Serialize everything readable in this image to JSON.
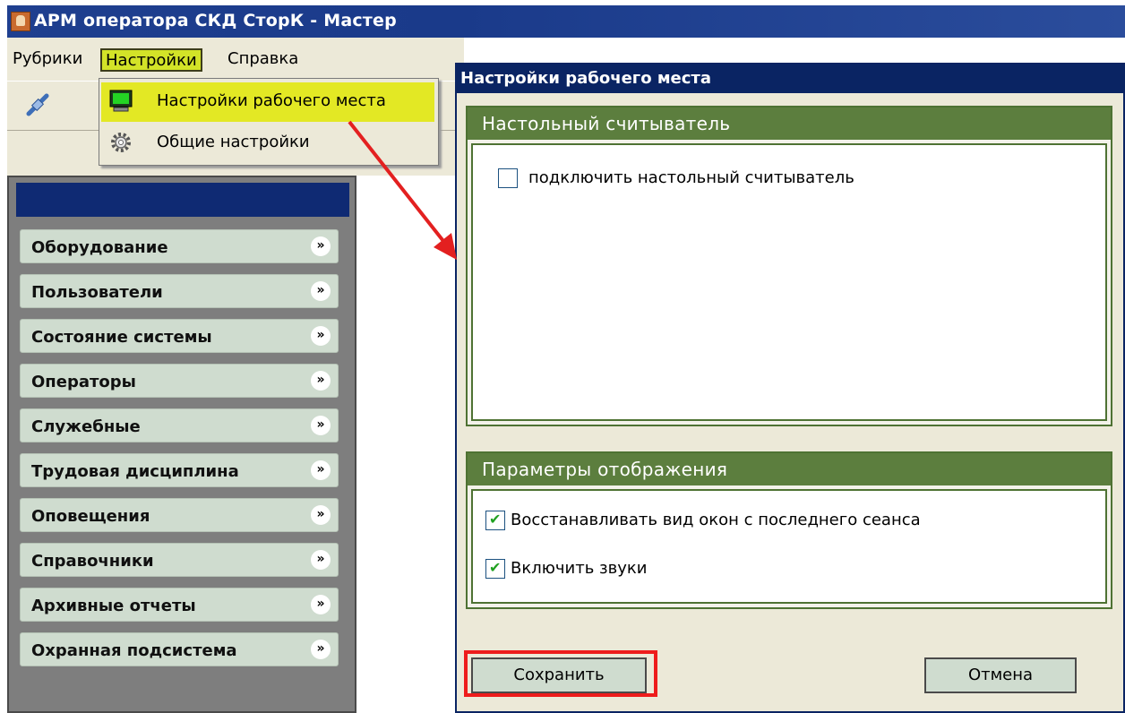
{
  "window": {
    "title": "АРМ оператора СКД СторК - Мастер"
  },
  "menubar": {
    "items": [
      {
        "label": "Рубрики"
      },
      {
        "label": "Настройки"
      },
      {
        "label": "Справка"
      }
    ]
  },
  "dropdown": {
    "items": [
      {
        "label": "Настройки рабочего места",
        "icon": "monitor-icon"
      },
      {
        "label": "Общие настройки",
        "icon": "gear-icon"
      }
    ]
  },
  "sidebar": {
    "items": [
      {
        "label": "Оборудование"
      },
      {
        "label": "Пользователи"
      },
      {
        "label": "Состояние системы"
      },
      {
        "label": "Операторы"
      },
      {
        "label": "Служебные"
      },
      {
        "label": "Трудовая дисциплина"
      },
      {
        "label": "Оповещения"
      },
      {
        "label": "Справочники"
      },
      {
        "label": "Архивные отчеты"
      },
      {
        "label": "Охранная подсистема"
      }
    ]
  },
  "dialog": {
    "title": "Настройки рабочего места",
    "reader_group": {
      "title": "Настольный считыватель",
      "checkbox_label": "подключить настольный считыватель",
      "checked": false
    },
    "display_group": {
      "title": "Параметры отображения",
      "restore_label": "Восстанавливать вид окон с последнего сеанса",
      "restore_checked": true,
      "sounds_label": "Включить звуки",
      "sounds_checked": true
    },
    "save_label": "Сохранить",
    "cancel_label": "Отмена"
  },
  "colors": {
    "titlebar": "#1f3f8f",
    "menu_highlight": "#d3e328",
    "group_header": "#5c7e3e",
    "category_bg": "#cfdccf",
    "annotation": "#ee1c1c"
  }
}
